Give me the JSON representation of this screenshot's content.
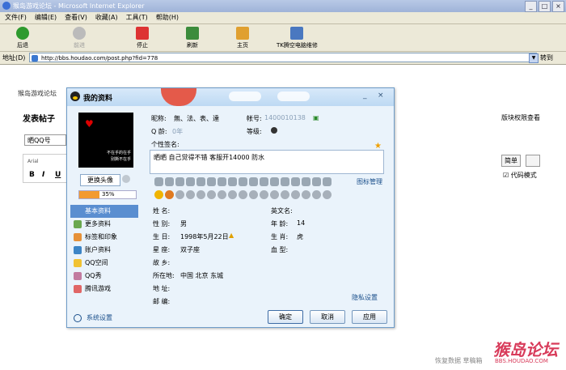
{
  "browser": {
    "title": "猴岛游戏论坛 - Microsoft Internet Explorer",
    "menu": [
      "文件(F)",
      "编辑(E)",
      "查看(V)",
      "收藏(A)",
      "工具(T)",
      "帮助(H)"
    ],
    "toolbar": {
      "back": "后退",
      "forward": "前进",
      "stop": "停止",
      "refresh": "刷新",
      "home": "主页",
      "tk": "TK腾空电脑维修"
    },
    "address_label": "地址(D)",
    "url": "http://bbs.houdao.com/post.php?fid=778",
    "go": "转到"
  },
  "page": {
    "breadcrumb": "猴岛游戏论坛",
    "post_title": "发表帖子",
    "permission": "版块权限查看",
    "select_qq": "晒QQ号",
    "font": "Arial",
    "format": [
      "B",
      "I",
      "U"
    ],
    "simple": "简单",
    "code_mode": "代码模式",
    "footer": "恢复数据   草稿箱",
    "watermark": "猴岛论坛",
    "watermark_url": "BBS.HOUDAO.COM"
  },
  "dialog": {
    "title": "我的资料",
    "minimize": "_",
    "close": "×",
    "avatar_text": [
      "不在乎的在乎",
      "别撕不在乎"
    ],
    "change_avatar": "更换头像",
    "progress": {
      "value": 0.35,
      "label": "35%"
    },
    "nav": [
      {
        "label": "基本资料",
        "selected": true,
        "color": "#5a8ed0"
      },
      {
        "label": "更多资料",
        "selected": false,
        "color": "#6aa84f"
      },
      {
        "label": "标签和印象",
        "selected": false,
        "color": "#e69138"
      },
      {
        "label": "账户资料",
        "selected": false,
        "color": "#3d85c6"
      },
      {
        "label": "QQ空间",
        "selected": false,
        "color": "#f1c232"
      },
      {
        "label": "QQ秀",
        "selected": false,
        "color": "#c27ba0"
      },
      {
        "label": "腾讯游戏",
        "selected": false,
        "color": "#e06666"
      }
    ],
    "system_settings": "系统设置",
    "profile": {
      "nickname_label": "昵称:",
      "nickname": "無、法、表、達",
      "account_label": "帐号:",
      "account": "1400010138",
      "qage_label": "Q 龄:",
      "qage": "0年",
      "level_label": "等级:",
      "signature_label": "个性签名:",
      "signature": "晒晒 自己觉得不错 客服开14000 防水",
      "icon_manage": "图标管理",
      "fields": {
        "name": "姓    名:",
        "english_name": "英文名:",
        "gender_label": "性    别:",
        "gender": "男",
        "age_label": "年    龄:",
        "age": "14",
        "birthday_label": "生    日:",
        "birthday": "1998年5月22日",
        "zodiac_label": "生    肖:",
        "zodiac": "虎",
        "star_label": "星    座:",
        "star": "双子座",
        "blood_label": "血    型:",
        "hometown_label": "故    乡:",
        "location_label": "所在地:",
        "location": "中国  北京  东城",
        "address_label": "地    址:",
        "postcode_label": "邮    编:"
      },
      "privacy": "隐私设置"
    },
    "buttons": {
      "ok": "确定",
      "cancel": "取消",
      "apply": "应用"
    }
  }
}
